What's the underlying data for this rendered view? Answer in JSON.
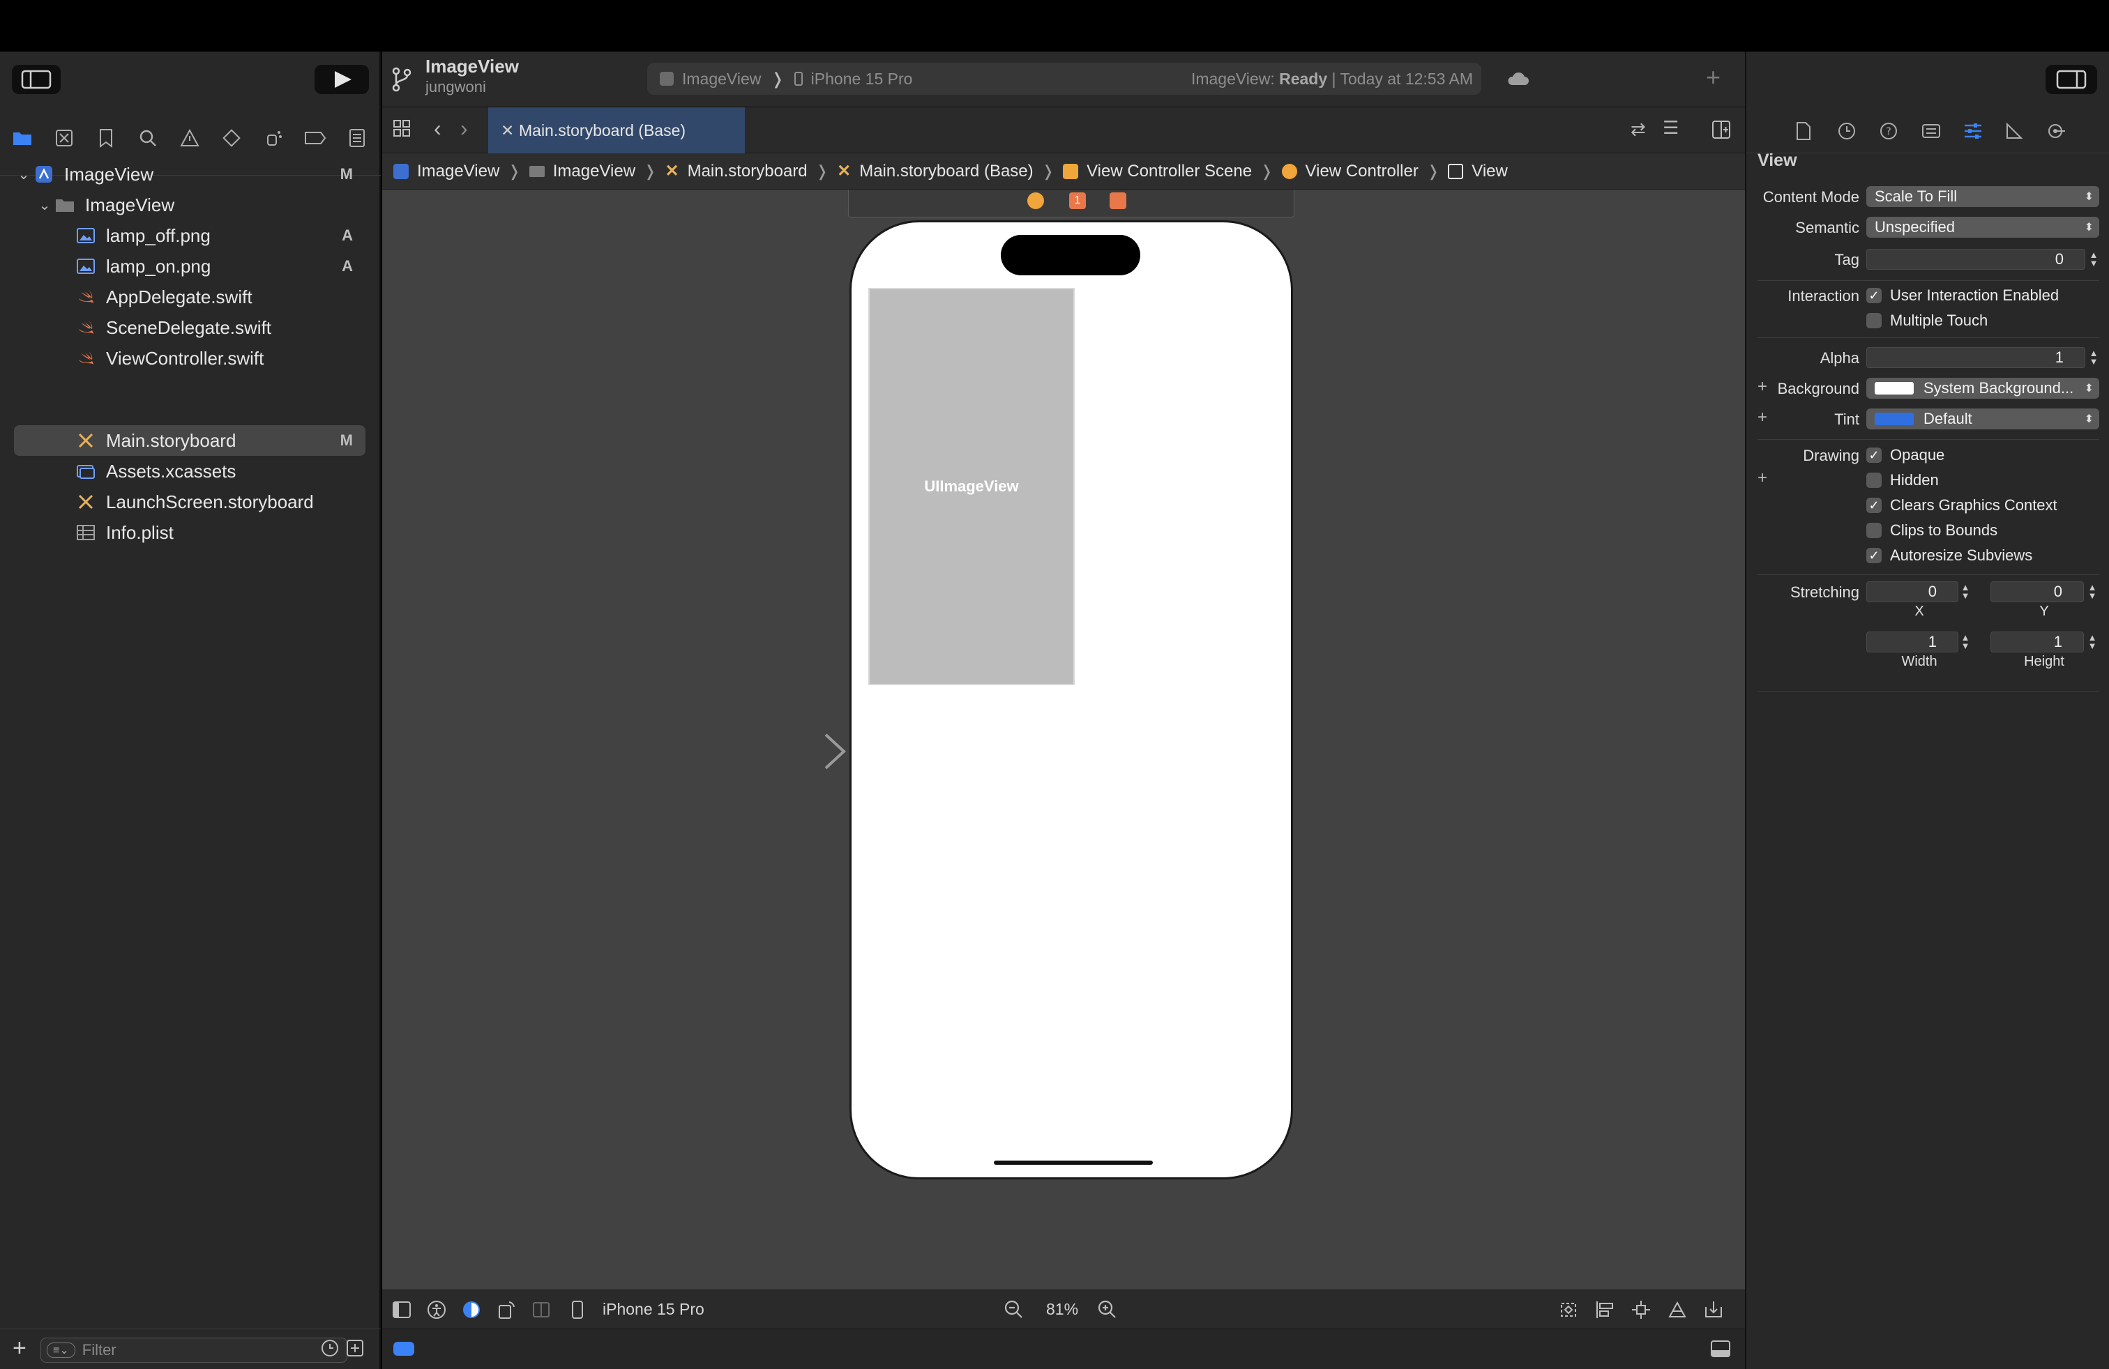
{
  "project": {
    "name": "ImageView",
    "owner": "jungwoni"
  },
  "scheme": {
    "target": "ImageView",
    "device": "iPhone 15 Pro"
  },
  "status": {
    "prefix": "ImageView: ",
    "state": "Ready",
    "suffix": " | Today at 12:53 AM"
  },
  "editor_tab": "Main.storyboard (Base)",
  "navigator": {
    "tree": [
      {
        "label": "ImageView",
        "badge": "M",
        "icon": "project-icon",
        "level": 0,
        "disclosure": "open"
      },
      {
        "label": "ImageView",
        "badge": "",
        "icon": "folder-icon",
        "level": 1,
        "disclosure": "open"
      },
      {
        "label": "lamp_off.png",
        "badge": "A",
        "icon": "image-file-icon",
        "level": 2
      },
      {
        "label": "lamp_on.png",
        "badge": "A",
        "icon": "image-file-icon",
        "level": 2
      },
      {
        "label": "AppDelegate.swift",
        "badge": "",
        "icon": "swift-file-icon",
        "level": 2
      },
      {
        "label": "SceneDelegate.swift",
        "badge": "",
        "icon": "swift-file-icon",
        "level": 2
      },
      {
        "label": "ViewController.swift",
        "badge": "",
        "icon": "swift-file-icon",
        "level": 2
      },
      {
        "label": "Main.storyboard",
        "badge": "M",
        "icon": "storyboard-icon",
        "level": 2,
        "selected": true
      },
      {
        "label": "Assets.xcassets",
        "badge": "",
        "icon": "assets-icon",
        "level": 2
      },
      {
        "label": "LaunchScreen.storyboard",
        "badge": "",
        "icon": "storyboard-icon",
        "level": 2
      },
      {
        "label": "Info.plist",
        "badge": "",
        "icon": "plist-icon",
        "level": 2
      }
    ],
    "filter_placeholder": "Filter"
  },
  "breadcrumbs": [
    "ImageView",
    "ImageView",
    "Main.storyboard",
    "Main.storyboard (Base)",
    "View Controller Scene",
    "View Controller",
    "View"
  ],
  "canvas": {
    "image_view_label": "UIImageView"
  },
  "bottom_bar": {
    "device": "iPhone 15 Pro",
    "zoom": "81%"
  },
  "inspector": {
    "section_title": "View",
    "content_mode": {
      "label": "Content Mode",
      "value": "Scale To Fill"
    },
    "semantic": {
      "label": "Semantic",
      "value": "Unspecified"
    },
    "tag": {
      "label": "Tag",
      "value": "0"
    },
    "interaction": {
      "label": "Interaction",
      "options": [
        {
          "label": "User Interaction Enabled",
          "checked": true
        },
        {
          "label": "Multiple Touch",
          "checked": false
        }
      ]
    },
    "alpha": {
      "label": "Alpha",
      "value": "1"
    },
    "background": {
      "label": "Background",
      "value": "System Background...",
      "swatch": "#ffffff"
    },
    "tint": {
      "label": "Tint",
      "value": "Default",
      "swatch": "#2f6fe0"
    },
    "drawing": {
      "label": "Drawing",
      "options": [
        {
          "label": "Opaque",
          "checked": true
        },
        {
          "label": "Hidden",
          "checked": false
        },
        {
          "label": "Clears Graphics Context",
          "checked": true
        },
        {
          "label": "Clips to Bounds",
          "checked": false
        },
        {
          "label": "Autoresize Subviews",
          "checked": true
        }
      ]
    },
    "stretching": {
      "label": "Stretching",
      "x": "0",
      "y": "0",
      "width": "1",
      "height": "1",
      "x_label": "X",
      "y_label": "Y",
      "width_label": "Width",
      "height_label": "Height"
    }
  },
  "colors": {
    "accent": "#3b82f6",
    "canvas": "#424242",
    "panel": "#282828"
  }
}
